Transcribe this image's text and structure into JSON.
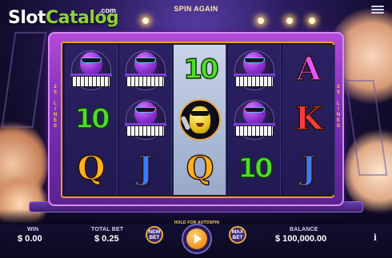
{
  "brand": {
    "word1": "Slot",
    "word2": "Catalog",
    "suffix": ".com"
  },
  "header": {
    "status_text": "SPIN AGAIN"
  },
  "machine": {
    "side_sign": "25 LINES"
  },
  "reels": [
    [
      "plum-keyboard",
      "10",
      "Q"
    ],
    [
      "plum-keyboard",
      "plum-keyboard",
      "J"
    ],
    [
      "10",
      "lemon-singer",
      "Q"
    ],
    [
      "plum-keyboard",
      "plum-keyboard",
      "10"
    ],
    [
      "A",
      "K",
      "J"
    ]
  ],
  "colors": {
    "A": "#e454ff",
    "K": "#ff3a3a",
    "Q": "#ffb11f",
    "J": "#3b7cff",
    "10": "#4fdc2c",
    "accent": "#f29a2b"
  },
  "footer": {
    "win_label": "WIN",
    "win_value": "$ 0.00",
    "total_bet_label": "TOTAL BET",
    "total_bet_value": "$ 0.25",
    "new_bet_label": "NEW BET",
    "max_bet_label": "MAX BET",
    "hold_label": "HOLD FOR AUTOSPIN",
    "balance_label": "BALANCE",
    "balance_value": "$ 100,000.00",
    "info_label": "i"
  },
  "icons": [
    "menu-icon",
    "play-icon",
    "info-icon"
  ]
}
